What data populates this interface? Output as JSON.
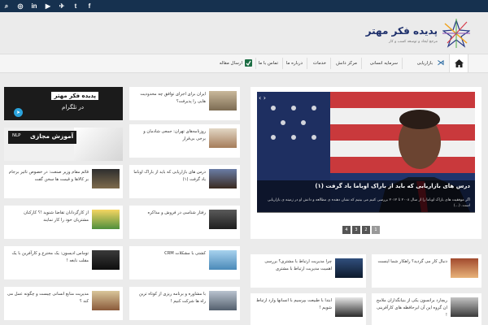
{
  "topbar": {
    "social": [
      "f",
      "t",
      "✈",
      "▶",
      "in",
      "◎",
      "⌕"
    ]
  },
  "header": {
    "site_name": "پدیده فکر مهتر",
    "tagline": "مرجع ایجاد و توسعه کسب و کار"
  },
  "nav": {
    "items": [
      "بازاریابی",
      "سرمایه انسانی",
      "مرکز دانش",
      "خدمات",
      "درباره ما",
      "تماس با ما",
      "ارسال مقاله"
    ]
  },
  "banners": {
    "telegram": {
      "title": "پدیده فکر مهتر",
      "subtitle": "در تلگرام"
    },
    "training": {
      "title": "آموزش مجازی",
      "badge": "NLP"
    }
  },
  "hero": {
    "title": "درس های بازاریابی که باید از باراک اوباما یاد گرفت (۱)",
    "description": "اگر موفقیت های باراک اوباما را از سال ۲۰۰۸ تا ۲۰۱۲ بررسی کنیم می بینیم که نشان دهنده ی مطالعه و دانش او در زمینه ی بازاریابی است. (...)",
    "pages": [
      "1",
      "2",
      "3",
      "4"
    ]
  },
  "col_mid": [
    "ایران برای اجرای توافق چه محدودیت هایی را پذیرفت؟",
    "روزنامه‌های تهران: جمعی شادمان و برخی بی‌قرار",
    "درس های بازاریابی که باید از باراک اوباما یاد گرفت (۱)",
    "رفتار شناسی در فروش و مذاکره",
    "کشتی با مشکلات CRM",
    "با مشاوره و برنامه ریزی از کوتاه ترین راه ها شرکت کنیم !"
  ],
  "col_left": [
    "قائم مقام وزیر صنعت: در خصوص تاثیر برجام بر کالاها و قیمت ها سخن گفت",
    "از کارگردانان تقاضا شنوید !؟ کارکنان مشتریان خود را کار نمایند",
    "توماس ادیسون: یک مخترع و کارآفرین با یک مقلب نابغه !",
    "مدیریت منابع انسانی چیست و چگونه عمل می کند ؟"
  ],
  "col_right": [
    "چرا مدیریت ارتباط با مشتری؟ بررسی اهمیت مدیریت ارتباط با مشتری",
    "ابتدا با طبیعت بپرسیم با انسانها وارد ارتباط شویم !",
    "دنبال کار می گردید؟ راهکار شما اینست",
    "ریچارد برانسون یکی از بنیانگذاران ملامح ان گروه این آن ابرحافظه های کارآفرینی !"
  ]
}
